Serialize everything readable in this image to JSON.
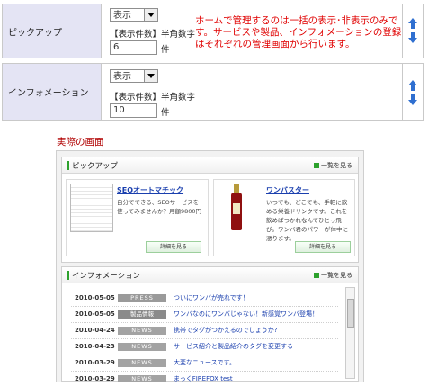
{
  "settings": {
    "pickup": {
      "label": "ピックアップ",
      "display_value": "表示",
      "count_label": "【表示件数】半角数字",
      "count_value": "6",
      "unit": "件"
    },
    "info": {
      "label": "インフォメーション",
      "display_value": "表示",
      "count_label": "【表示件数】半角数字",
      "count_value": "10",
      "unit": "件"
    },
    "note": "ホームで管理するのは一括の表示･非表示のみです。サービスや製品、インフォメーションの登録はそれぞれの管理画面から行います。"
  },
  "preview": {
    "caption": "実際の画面",
    "pickup_panel": {
      "title": "ピックアップ",
      "more": "一覧を見る",
      "cards": [
        {
          "title": "SEOオートマチック",
          "body": "自分でできる、SEOサービスを使ってみませんか？月額9800円",
          "button": "詳細を見る"
        },
        {
          "title": "ワンバスター",
          "body": "いつでも、どこでも、手軽に飲める栄養ドリンクです。これを飲めばつかれなんてひとっ飛び。ワンバ君のパワーが体中に漲ります。",
          "button": "詳細を見る"
        }
      ]
    },
    "info_panel": {
      "title": "インフォメーション",
      "more": "一覧を見る",
      "rows": [
        {
          "date": "2010-05-05",
          "badge": "PRESS",
          "badge_color": "#9a9a9a",
          "text": "ついにワンバが売れです！"
        },
        {
          "date": "2010-05-05",
          "badge": "製品情報",
          "badge_color": "#8a8a8a",
          "text": "ワンバなのにワンバじゃない！新感覚ワンバ登場！"
        },
        {
          "date": "2010-04-24",
          "badge": "NEWS",
          "badge_color": "#a3a3a3",
          "text": "携帯でタグがつかえるのでしょうか?"
        },
        {
          "date": "2010-04-23",
          "badge": "NEWS",
          "badge_color": "#a3a3a3",
          "text": "サービス紹介と製品紹介のタグを変更する"
        },
        {
          "date": "2010-03-29",
          "badge": "NEWS",
          "badge_color": "#a3a3a3",
          "text": "大変なニュースです。"
        },
        {
          "date": "2010-03-29",
          "badge": "NEWS",
          "badge_color": "#a3a3a3",
          "text": "まっくFIREFOX test"
        }
      ]
    }
  }
}
